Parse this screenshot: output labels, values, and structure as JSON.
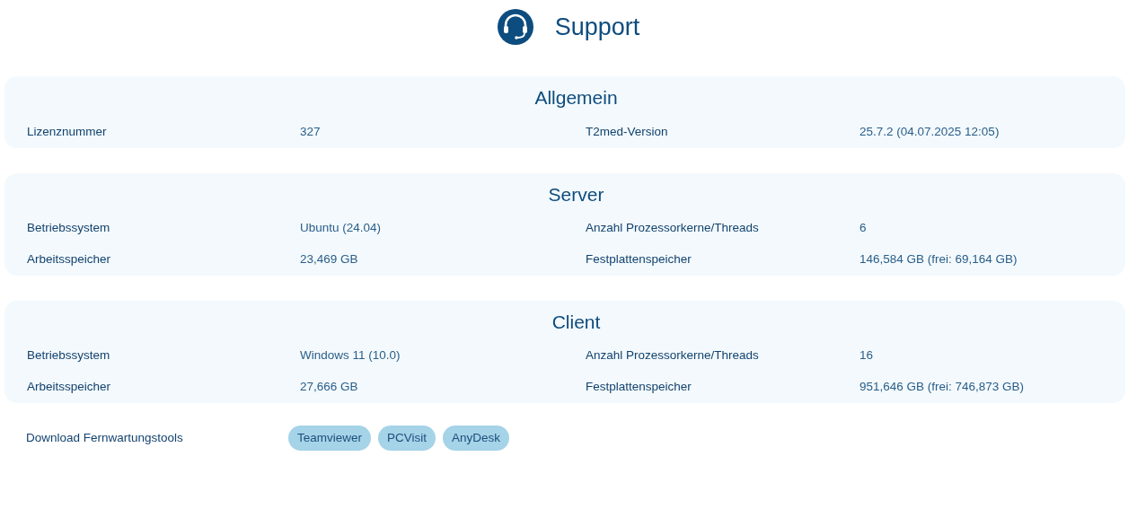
{
  "title": "Support",
  "sections": [
    {
      "heading": "Allgemein",
      "fields": [
        {
          "label": "Lizenznummer",
          "value": "327"
        },
        {
          "label": "T2med-Version",
          "value": "25.7.2 (04.07.2025 12:05)"
        }
      ]
    },
    {
      "heading": "Server",
      "fields": [
        {
          "label": "Betriebssystem",
          "value": "Ubuntu (24.04)"
        },
        {
          "label": "Anzahl Prozessorkerne/Threads",
          "value": "6"
        },
        {
          "label": "Arbeitsspeicher",
          "value": "23,469 GB"
        },
        {
          "label": "Festplattenspeicher",
          "value": "146,584 GB (frei: 69,164 GB)"
        }
      ]
    },
    {
      "heading": "Client",
      "fields": [
        {
          "label": "Betriebssystem",
          "value": "Windows 11 (10.0)"
        },
        {
          "label": "Anzahl Prozessorkerne/Threads",
          "value": "16"
        },
        {
          "label": "Arbeitsspeicher",
          "value": "27,666 GB"
        },
        {
          "label": "Festplattenspeicher",
          "value": "951,646 GB (frei: 746,873 GB)"
        }
      ]
    }
  ],
  "downloads": {
    "label": "Download Fernwartungstools",
    "buttons": [
      "Teamviewer",
      "PCVisit",
      "AnyDesk"
    ]
  }
}
